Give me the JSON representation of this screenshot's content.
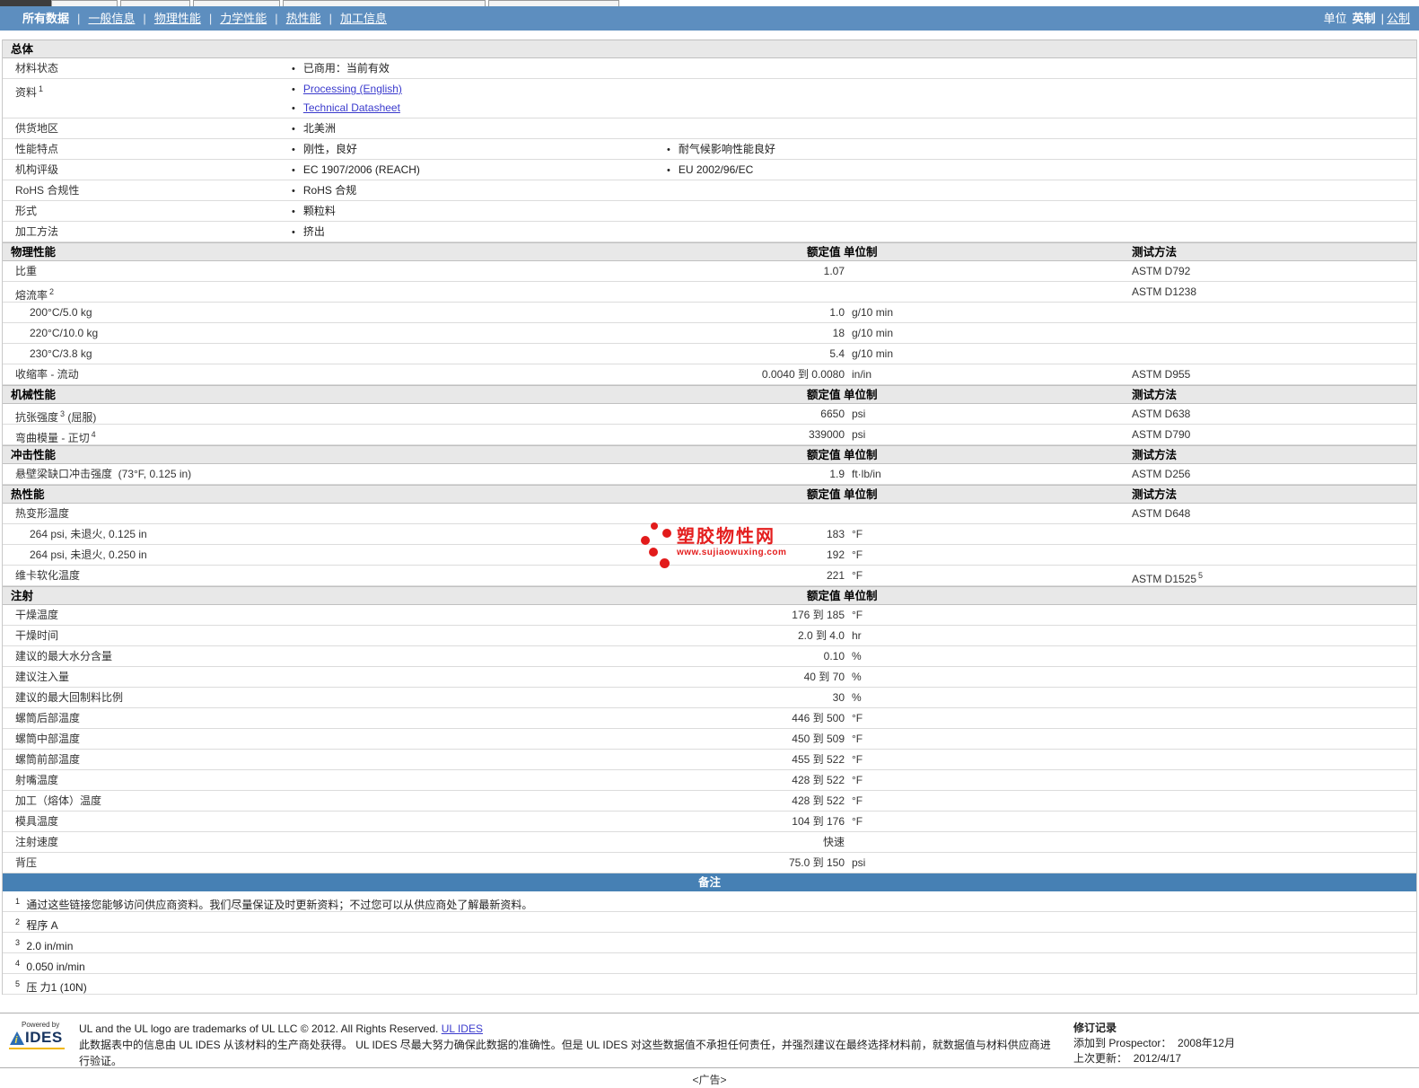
{
  "colors": {
    "nav_blue": "#5d8ebf",
    "notes_blue": "#4680b4",
    "link": "#3b3bcd",
    "watermark_red": "#e41e1e"
  },
  "nav": {
    "tabs": [
      {
        "label": "所有数据",
        "active": true
      },
      {
        "label": "一般信息",
        "active": false
      },
      {
        "label": "物理性能",
        "active": false
      },
      {
        "label": "力学性能",
        "active": false
      },
      {
        "label": "热性能",
        "active": false
      },
      {
        "label": "加工信息",
        "active": false
      }
    ],
    "units_label": "单位",
    "unit_current": "英制",
    "unit_separator": "|",
    "unit_alt": "公制"
  },
  "watermark": {
    "title": "塑胶物性网",
    "url": "www.sujiaowuxing.com"
  },
  "sections": [
    {
      "type": "bullets",
      "title": "总体",
      "rows": [
        {
          "label": "材料状态",
          "col1": [
            {
              "text": "已商用：当前有效",
              "link": false
            }
          ]
        },
        {
          "label": "资料",
          "sup": "1",
          "col1": [
            {
              "text": "Processing (English)",
              "link": true
            },
            {
              "text": "Technical Datasheet",
              "link": true
            }
          ]
        },
        {
          "label": "供货地区",
          "col1": [
            {
              "text": "北美洲",
              "link": false
            }
          ]
        },
        {
          "label": "性能特点",
          "col1": [
            {
              "text": "刚性，良好",
              "link": false
            }
          ],
          "col2": [
            {
              "text": "耐气候影响性能良好",
              "link": false
            }
          ]
        },
        {
          "label": "机构评级",
          "col1": [
            {
              "text": "EC 1907/2006 (REACH)",
              "link": false
            }
          ],
          "col2": [
            {
              "text": "EU 2002/96/EC",
              "link": false
            }
          ]
        },
        {
          "label": "RoHS 合规性",
          "col1": [
            {
              "text": "RoHS 合规",
              "link": false
            }
          ]
        },
        {
          "label": "形式",
          "col1": [
            {
              "text": "颗粒料",
              "link": false
            }
          ]
        },
        {
          "label": "加工方法",
          "col1": [
            {
              "text": "挤出",
              "link": false
            }
          ]
        }
      ]
    },
    {
      "type": "props",
      "title": "物理性能",
      "col_value": "额定值 单位制",
      "col_method": "测试方法",
      "rows": [
        {
          "label": "比重",
          "value": "1.07",
          "unit": "",
          "method": "ASTM D792"
        },
        {
          "label": "熔流率",
          "sup": "2",
          "method": "ASTM D1238"
        },
        {
          "label": "200°C/5.0 kg",
          "indent": true,
          "value": "1.0",
          "unit": "g/10 min"
        },
        {
          "label": "220°C/10.0 kg",
          "indent": true,
          "value": "18",
          "unit": "g/10 min"
        },
        {
          "label": "230°C/3.8 kg",
          "indent": true,
          "value": "5.4",
          "unit": "g/10 min"
        },
        {
          "label": "收缩率 - 流动",
          "value": "0.0040 到 0.0080",
          "unit": "in/in",
          "method": "ASTM D955"
        }
      ]
    },
    {
      "type": "props",
      "title": "机械性能",
      "col_value": "额定值 单位制",
      "col_method": "测试方法",
      "rows": [
        {
          "label": "抗张强度",
          "sup": "3",
          "label2": "(屈服)",
          "value": "6650",
          "unit": "psi",
          "method": "ASTM D638"
        },
        {
          "label": "弯曲模量 - 正切",
          "sup": "4",
          "value": "339000",
          "unit": "psi",
          "method": "ASTM D790"
        }
      ]
    },
    {
      "type": "props",
      "title": "冲击性能",
      "col_value": "额定值 单位制",
      "col_method": "测试方法",
      "rows": [
        {
          "label": "悬壁梁缺口冲击强度  (73°F, 0.125 in)",
          "value": "1.9",
          "unit": "ft·lb/in",
          "method": "ASTM D256"
        }
      ]
    },
    {
      "type": "props",
      "title": "热性能",
      "col_value": "额定值 单位制",
      "col_method": "测试方法",
      "rows": [
        {
          "label": "热变形温度",
          "method": "ASTM D648"
        },
        {
          "label": "264 psi, 未退火, 0.125 in",
          "indent": true,
          "value": "183",
          "unit": "°F"
        },
        {
          "label": "264 psi, 未退火, 0.250 in",
          "indent": true,
          "value": "192",
          "unit": "°F"
        },
        {
          "label": "维卡软化温度",
          "value": "221",
          "unit": "°F",
          "method": "ASTM D1525",
          "method_sup": "5"
        }
      ]
    },
    {
      "type": "props",
      "title": "注射",
      "col_value": "额定值 单位制",
      "col_method": "",
      "rows": [
        {
          "label": "干燥温度",
          "value": "176 到 185",
          "unit": "°F"
        },
        {
          "label": "干燥时间",
          "value": "2.0 到 4.0",
          "unit": "hr"
        },
        {
          "label": "建议的最大水分含量",
          "value": "0.10",
          "unit": "%"
        },
        {
          "label": "建议注入量",
          "value": "40 到 70",
          "unit": "%"
        },
        {
          "label": "建议的最大回制料比例",
          "value": "30",
          "unit": "%"
        },
        {
          "label": "螺筒后部温度",
          "value": "446 到 500",
          "unit": "°F"
        },
        {
          "label": "螺筒中部温度",
          "value": "450 到 509",
          "unit": "°F"
        },
        {
          "label": "螺筒前部温度",
          "value": "455 到 522",
          "unit": "°F"
        },
        {
          "label": "射嘴温度",
          "value": "428 到 522",
          "unit": "°F"
        },
        {
          "label": "加工（熔体）温度",
          "value": "428 到 522",
          "unit": "°F"
        },
        {
          "label": "模具温度",
          "value": "104 到 176",
          "unit": "°F"
        },
        {
          "label": "注射速度",
          "value": "快速"
        },
        {
          "label": "背压",
          "value": "75.0 到 150",
          "unit": "psi"
        }
      ]
    }
  ],
  "notes": {
    "title": "备注",
    "items": [
      {
        "sup": "1",
        "text": "通过这些链接您能够访问供应商资料。我们尽量保证及时更新资料；不过您可以从供应商处了解最新资料。"
      },
      {
        "sup": "2",
        "text": "程序 A"
      },
      {
        "sup": "3",
        "text": "2.0 in/min"
      },
      {
        "sup": "4",
        "text": "0.050 in/min"
      },
      {
        "sup": "5",
        "text": "压 力1 (10N)"
      }
    ]
  },
  "footer": {
    "logo": {
      "powered_by": "Powered by",
      "brand": "IDES"
    },
    "trademark_text": "UL and the UL logo are trademarks of UL LLC © 2012. All Rights Reserved. ",
    "trademark_link": "UL IDES",
    "disclaimer": "此数据表中的信息由  UL IDES 从该材料的生产商处获得。 UL IDES 尽最大努力确保此数据的准确性。但是  UL IDES 对这些数据值不承担任何责任，并强烈建议在最终选择材料前，就数据值与材料供应商进行验证。",
    "revision": {
      "title": "修订记录",
      "added_label": "添加到  Prospector：",
      "added_value": "2008年12月",
      "updated_label": "上次更新：",
      "updated_value": "2012/4/17"
    }
  },
  "ad_label": "<广告>"
}
